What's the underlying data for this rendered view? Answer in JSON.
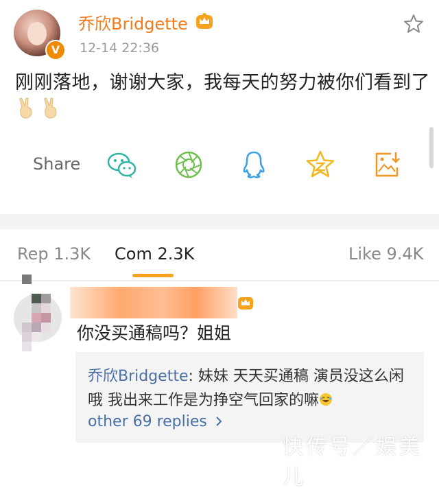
{
  "post": {
    "author": "乔欣Bridgette",
    "timestamp": "12-14 22:36",
    "text": "刚刚落地，谢谢大家，我每天的努力被你们看到了",
    "emoji_count": 2
  },
  "share": {
    "label": "Share",
    "icons": [
      "wechat-icon",
      "moments-icon",
      "qq-icon",
      "qzone-icon",
      "save-image-icon"
    ]
  },
  "tabs": {
    "rep": "Rep 1.3K",
    "com": "Com 2.3K",
    "like": "Like 9.4K"
  },
  "comment": {
    "text": "你没买通稿吗？姐姐",
    "reply_author": "乔欣Bridgette",
    "reply_part1": "妹妹 天天买通稿 演员没这么闲",
    "reply_part2": "哦 我出来工作是为挣空气回家的嘛",
    "more_replies": "other 69 replies"
  },
  "watermark": "快传号／娱美儿",
  "colors": {
    "brand_orange": "#f27c1d",
    "link_blue": "#4a6fa5",
    "tab_accent": "#f7a21b",
    "icon_green": "#2bb5a0",
    "icon_blue": "#3aa0e8",
    "icon_yellow": "#f2b81b",
    "icon_orange": "#f0961e"
  }
}
